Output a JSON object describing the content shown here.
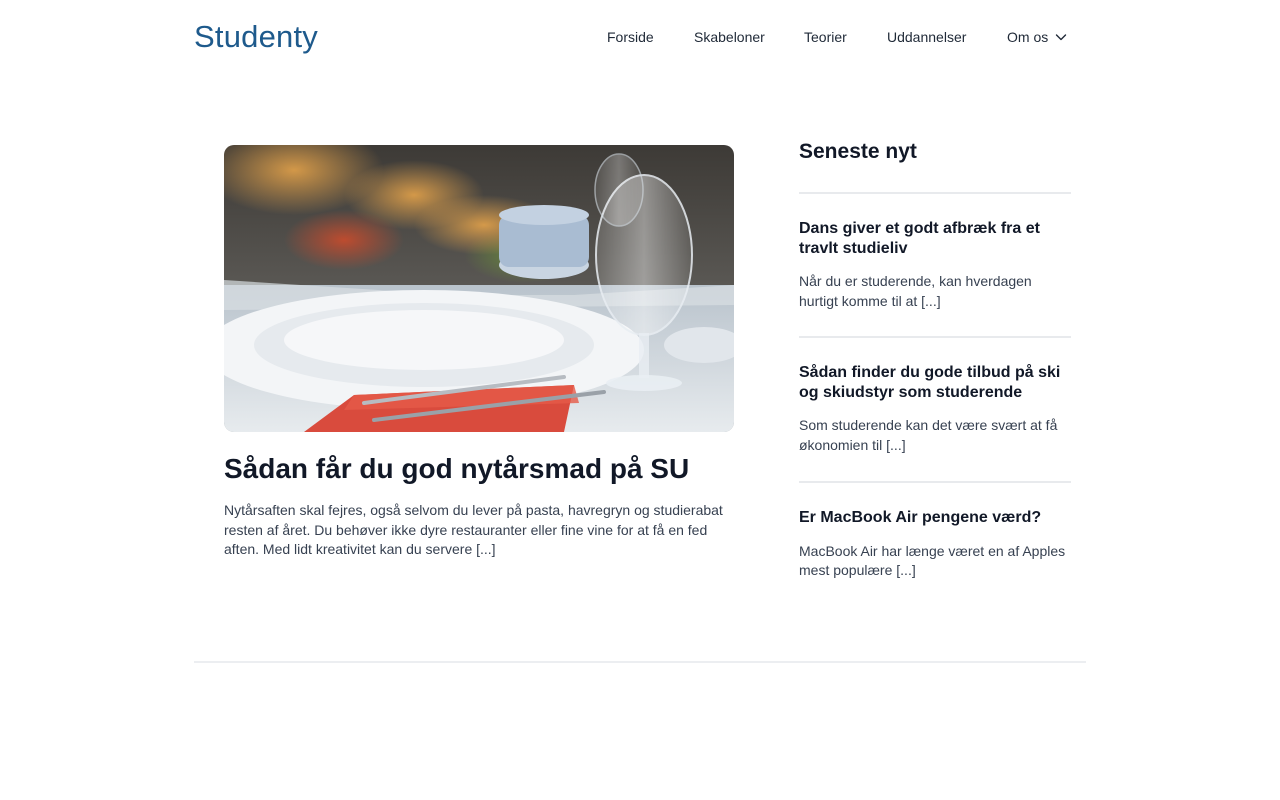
{
  "site": {
    "name": "Studenty"
  },
  "nav": {
    "items": [
      "Forside",
      "Skabeloner",
      "Teorier",
      "Uddannelser"
    ],
    "more_label": "Om os",
    "more_icon": "chevron-down-icon"
  },
  "feature": {
    "image": "dinner-table-photo",
    "title": "Sådan får du god nytårsmad på SU",
    "excerpt": "Nytårsaften skal fejres, også selvom du lever på pasta, havregryn og studierabat resten af året. Du behøver ikke dyre restauranter eller fine vine for at få en fed aften. Med lidt kreativitet kan du servere [...]"
  },
  "sidebar": {
    "title": "Seneste nyt",
    "items": [
      {
        "title": "Dans giver et godt afbræk fra et travlt studieliv",
        "excerpt": "Når du er studerende, kan hverdagen hurtigt komme til at [...]"
      },
      {
        "title": "Sådan finder du gode tilbud på ski og skiudstyr som studerende",
        "excerpt": "Som studerende kan det være svært at få økonomien til [...]"
      },
      {
        "title": "Er MacBook Air pengene værd?",
        "excerpt": "MacBook Air har længe været en af Apples mest populære [...]"
      }
    ]
  },
  "colors": {
    "brand": "#1e5a8c",
    "text": "#111827",
    "divider": "#e8eaed"
  }
}
